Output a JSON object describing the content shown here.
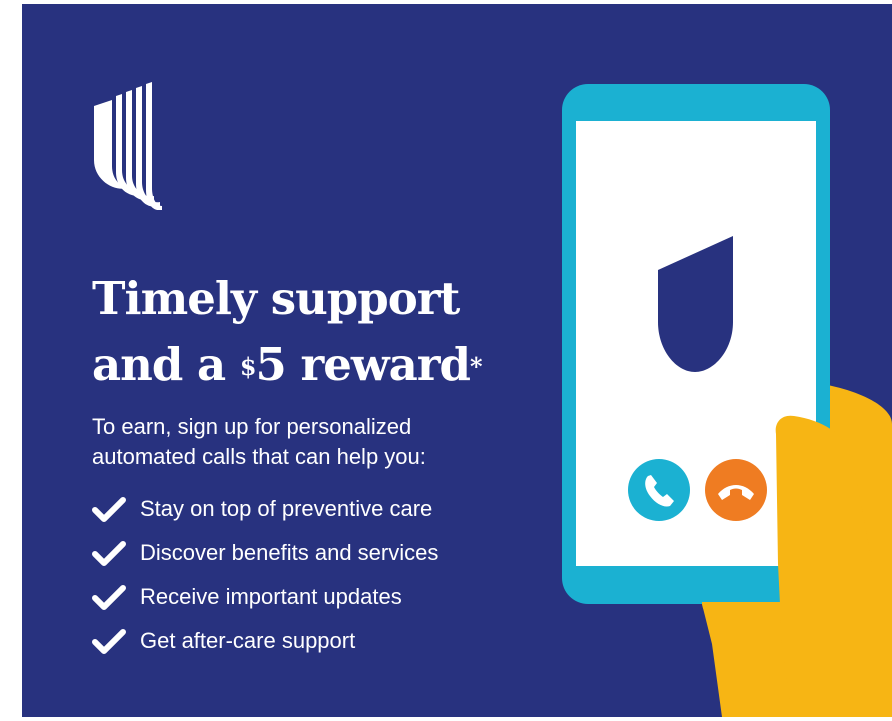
{
  "headline": {
    "line1": "Timely support",
    "line2_prefix": "and a ",
    "currency": "$",
    "amount": "5",
    "line2_suffix": " reward",
    "asterisk": "*"
  },
  "intro": {
    "line1": "To earn, sign up for personalized",
    "line2": "automated calls that can help you:"
  },
  "benefits": [
    "Stay on top of preventive care",
    "Discover benefits and services",
    "Receive important updates",
    "Get after-care support"
  ],
  "icons": {
    "logo": "brand-u-logo-icon",
    "check": "checkmark-icon",
    "accept": "phone-accept-icon",
    "decline": "phone-decline-icon"
  },
  "colors": {
    "background": "#28327f",
    "phone_frame": "#1bb1d2",
    "accept_button": "#1bb1d2",
    "decline_button": "#ef7c22",
    "hand": "#f7b514",
    "logo_mark": "#28327f"
  }
}
